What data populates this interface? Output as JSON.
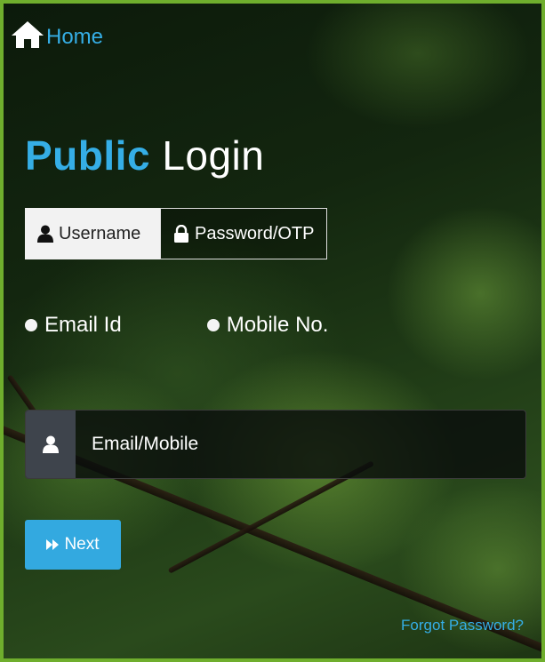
{
  "nav": {
    "home_label": "Home",
    "home_icon": "home-icon"
  },
  "login": {
    "title_accent": "Public",
    "title_rest": "Login"
  },
  "tabs": [
    {
      "label": "Username",
      "icon": "user-icon",
      "active": true
    },
    {
      "label": "Password/OTP",
      "icon": "lock-icon",
      "active": false
    }
  ],
  "radio_options": [
    {
      "label": "Email Id",
      "selected": false
    },
    {
      "label": "Mobile No.",
      "selected": false
    }
  ],
  "input": {
    "placeholder": "Email/Mobile",
    "value": "",
    "icon": "user-icon"
  },
  "next_button": {
    "label": "Next",
    "icon": "fast-forward-icon"
  },
  "forgot_password_label": "Forgot Password?",
  "colors": {
    "accent": "#35aee6",
    "button": "#33a9e0",
    "frame": "#6fae2d"
  }
}
